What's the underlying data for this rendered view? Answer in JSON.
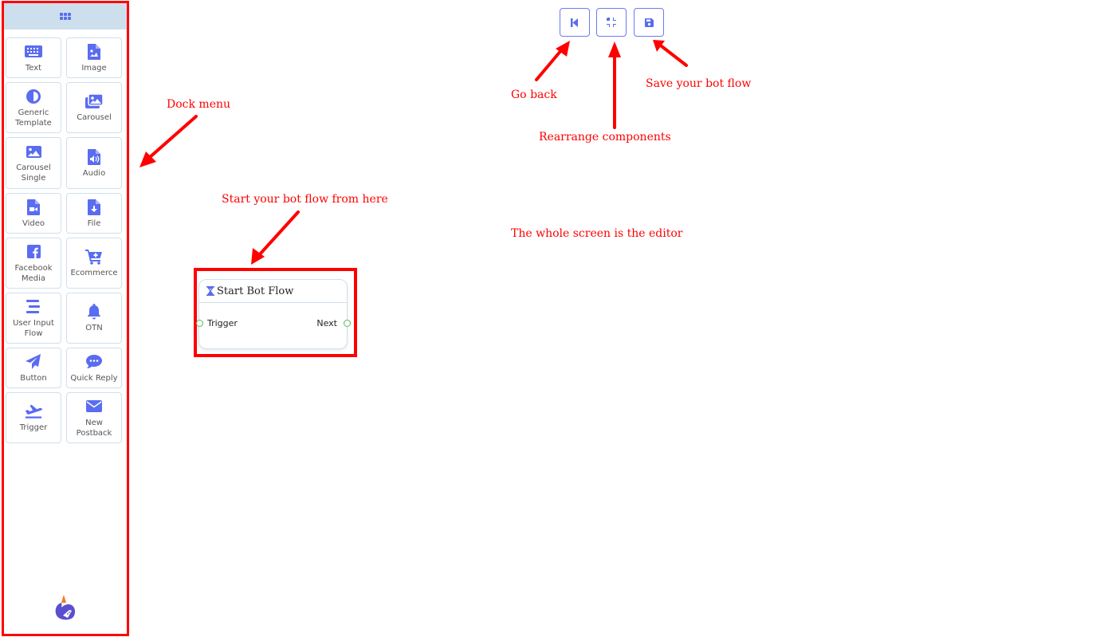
{
  "dock": {
    "header_icon": "grid-icon",
    "items": [
      {
        "label": "Text",
        "icon": "keyboard-icon"
      },
      {
        "label": "Image",
        "icon": "file-image-icon"
      },
      {
        "label": "Generic Template",
        "icon": "adjust-icon"
      },
      {
        "label": "Carousel",
        "icon": "images-icon"
      },
      {
        "label": "Carousel Single",
        "icon": "image-icon"
      },
      {
        "label": "Audio",
        "icon": "file-audio-icon"
      },
      {
        "label": "Video",
        "icon": "file-video-icon"
      },
      {
        "label": "File",
        "icon": "file-download-icon"
      },
      {
        "label": "Facebook Media",
        "icon": "facebook-icon"
      },
      {
        "label": "Ecommerce",
        "icon": "cart-plus-icon"
      },
      {
        "label": "User Input Flow",
        "icon": "align-center-icon"
      },
      {
        "label": "OTN",
        "icon": "bell-icon"
      },
      {
        "label": "Button",
        "icon": "paper-plane-icon"
      },
      {
        "label": "Quick Reply",
        "icon": "comment-dots-icon"
      },
      {
        "label": "Trigger",
        "icon": "plane-departure-icon"
      },
      {
        "label": "New Postback",
        "icon": "envelope-icon"
      }
    ],
    "logo": "app-logo"
  },
  "toolbar": {
    "buttons": [
      {
        "name": "go-back",
        "icon": "step-backward-icon"
      },
      {
        "name": "rearrange",
        "icon": "compress-icon"
      },
      {
        "name": "save",
        "icon": "save-icon"
      }
    ]
  },
  "annotations": {
    "dock_menu": "Dock menu",
    "go_back": "Go back",
    "rearrange": "Rearrange components",
    "save": "Save your bot flow",
    "start_here": "Start your bot flow from here",
    "editor": "The whole screen is the editor"
  },
  "node": {
    "title": "Start Bot Flow",
    "icon": "hourglass-icon",
    "input_port": "Trigger",
    "output_port": "Next"
  },
  "colors": {
    "accent": "#5a6cf0",
    "annotation": "#ff0000",
    "dock_header": "#cddfed",
    "port": "#5cb85c"
  }
}
